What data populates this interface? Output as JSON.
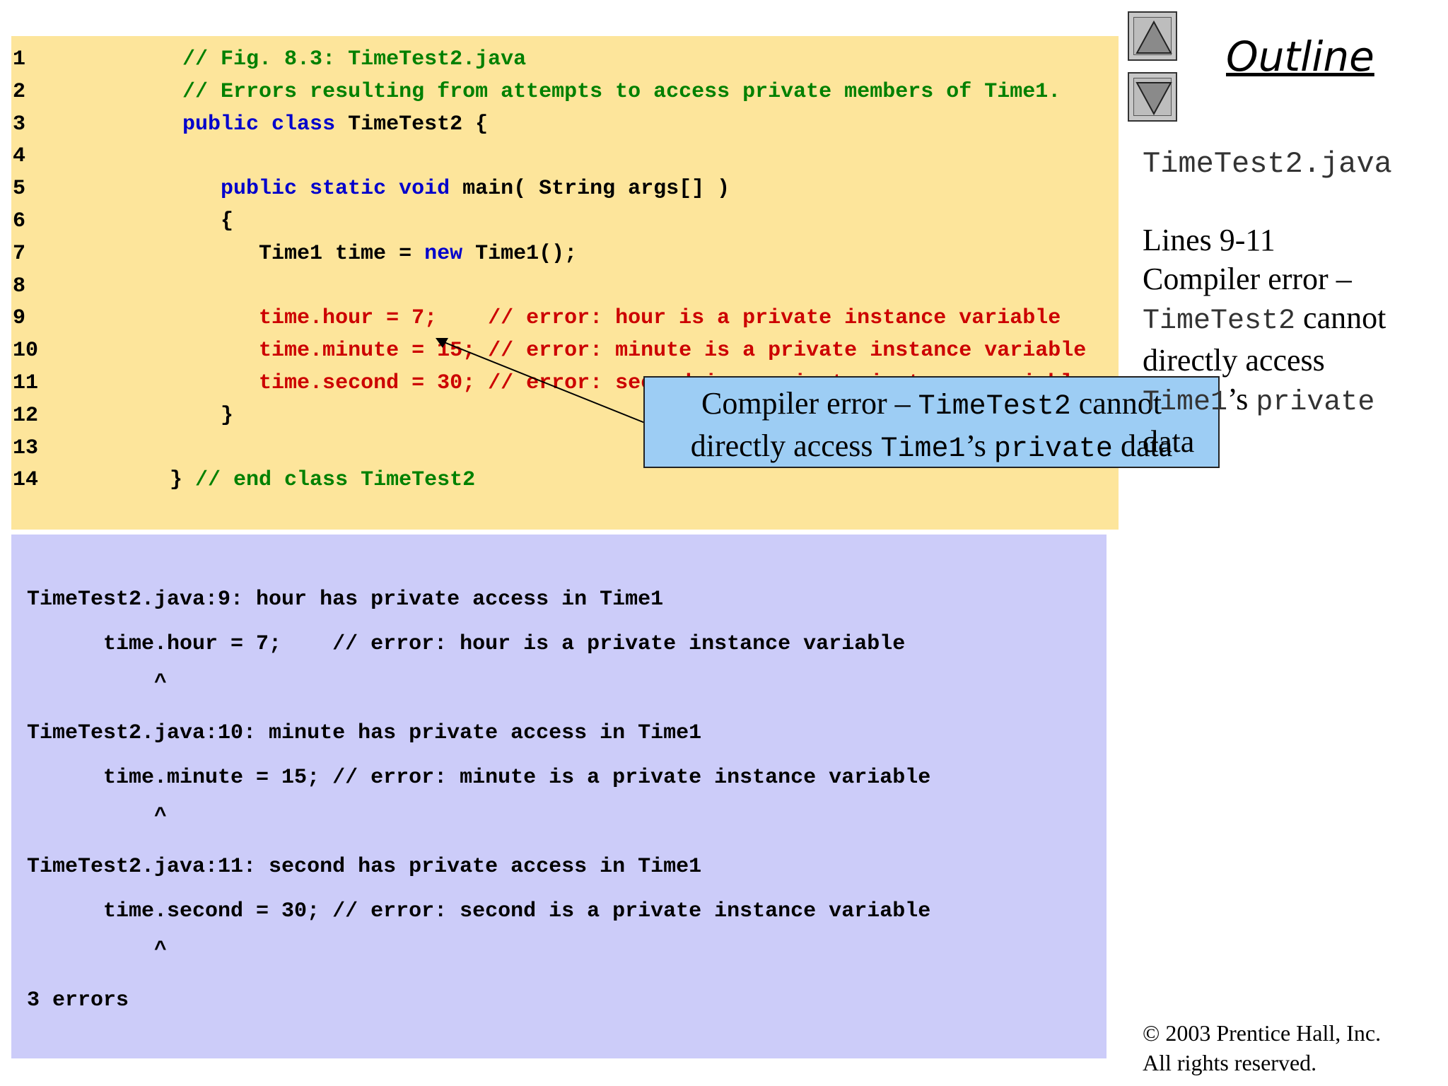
{
  "code_lines": [
    {
      "num": "1",
      "segments": [
        {
          "text": "      ",
          "cls": ""
        },
        {
          "text": "// Fig. 8.3: TimeTest2.java",
          "cls": "cm"
        }
      ]
    },
    {
      "num": "2",
      "segments": [
        {
          "text": "      ",
          "cls": ""
        },
        {
          "text": "// Errors resulting from attempts to access private members of Time1.",
          "cls": "cm"
        }
      ]
    },
    {
      "num": "3",
      "segments": [
        {
          "text": "      ",
          "cls": ""
        },
        {
          "text": "public class",
          "cls": "kw"
        },
        {
          "text": " TimeTest2 {",
          "cls": ""
        }
      ]
    },
    {
      "num": "4",
      "segments": []
    },
    {
      "num": "5",
      "segments": [
        {
          "text": "         ",
          "cls": ""
        },
        {
          "text": "public static void",
          "cls": "kw"
        },
        {
          "text": " main( String args[] )",
          "cls": ""
        }
      ]
    },
    {
      "num": "6",
      "segments": [
        {
          "text": "         {",
          "cls": ""
        }
      ]
    },
    {
      "num": "7",
      "segments": [
        {
          "text": "            Time1 time = ",
          "cls": ""
        },
        {
          "text": "new",
          "cls": "kw"
        },
        {
          "text": " Time1();",
          "cls": ""
        }
      ]
    },
    {
      "num": "8",
      "segments": []
    },
    {
      "num": "9",
      "segments": [
        {
          "text": "            ",
          "cls": ""
        },
        {
          "text": "time.hour = 7;    // error: hour is a private instance variable",
          "cls": "err"
        }
      ]
    },
    {
      "num": "10",
      "segments": [
        {
          "text": "            ",
          "cls": ""
        },
        {
          "text": "time.minute = 15; // error: minute is a private instance variable",
          "cls": "err"
        }
      ]
    },
    {
      "num": "11",
      "segments": [
        {
          "text": "            ",
          "cls": ""
        },
        {
          "text": "time.second = 30; // error: second is a private instance variable",
          "cls": "err"
        }
      ]
    },
    {
      "num": "12",
      "segments": [
        {
          "text": "         }",
          "cls": ""
        }
      ]
    },
    {
      "num": "13",
      "segments": []
    },
    {
      "num": "14",
      "segments": [
        {
          "text": "     } ",
          "cls": ""
        },
        {
          "text": "// end class TimeTest2",
          "cls": "cm"
        }
      ]
    }
  ],
  "output_lines": [
    "TimeTest2.java:9: hour has private access in Time1",
    "      time.hour = 7;    // error: hour is a private instance variable",
    "          ^",
    "TimeTest2.java:10: minute has private access in Time1",
    "      time.minute = 15; // error: minute is a private instance variable",
    "          ^",
    "TimeTest2.java:11: second has private access in Time1",
    "      time.second = 30; // error: second is a private instance variable",
    "          ^",
    "3 errors"
  ],
  "callout": {
    "line1_a": "Compiler error – ",
    "line1_b": "TimeTest2",
    "line1_c": " cannot",
    "line2_a": "directly access ",
    "line2_b": "Time1",
    "line2_c": "’s ",
    "line2_d": "private",
    "line2_e": " data"
  },
  "sidebar": {
    "outline_title": "Outline",
    "file_name": "TimeTest2.java",
    "note_line1": "Lines 9-11",
    "note_line2": "Compiler error –",
    "note_line3_code": "TimeTest2",
    "note_line3_text": " cannot",
    "note_line4": "directly access",
    "note_line5_code": "Time1",
    "note_line5_text": "’s ",
    "note_line5_code2": "private",
    "note_line6": "data"
  },
  "copyright": {
    "line1": "© 2003 Prentice Hall, Inc.",
    "line2": "All rights reserved."
  },
  "nav": {
    "up_icon": "triangle-up-icon",
    "down_icon": "triangle-down-icon"
  }
}
